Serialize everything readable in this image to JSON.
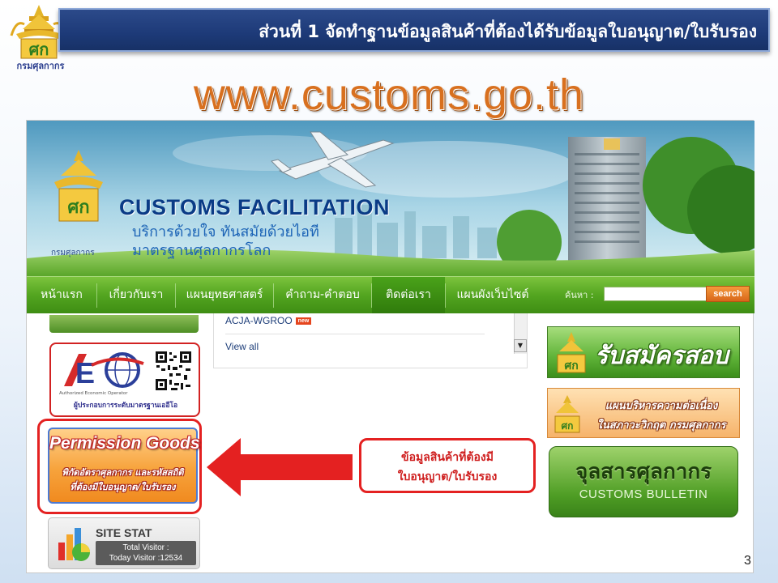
{
  "slide": {
    "logo_text": "กรมศุลกากร",
    "title": "ส่วนที่ 1 จัดทำฐานข้อมูลสินค้าที่ต้องได้รับข้อมูลใบอนุญาต/ใบรับรอง",
    "url": "www.customs.go.th",
    "page_number": "3"
  },
  "site": {
    "banner": {
      "title": "CUSTOMS FACILITATION",
      "subtitle_line1": "บริการด้วยใจ ทันสมัยด้วยไอที",
      "subtitle_line2": "มาตรฐานศุลกากรโลก",
      "logo_caption": "กรมศุลกากร"
    },
    "nav": {
      "items": [
        {
          "label": "หน้าแรก"
        },
        {
          "label": "เกี่ยวกับเรา"
        },
        {
          "label": "แผนยุทธศาสตร์"
        },
        {
          "label": "คำถาม-คำตอบ"
        },
        {
          "label": "ติดต่อเรา"
        },
        {
          "label": "แผนผังเว็บไซต์"
        }
      ],
      "search_label": "ค้นหา :",
      "search_value": "",
      "search_button": "search"
    },
    "news": {
      "item": "ACJA-WGROO",
      "badge": "new",
      "view_all": "View all"
    },
    "aeo": {
      "sub": "Authorized Economic Operator",
      "caption": "ผู้ประกอบการระดับมาตรฐานเออีโอ"
    },
    "permission": {
      "title": "Permission Goods",
      "line1": "พิกัดอัตราศุลกากร และรหัสสถิติ",
      "line2": "ที่ต้องมีใบอนุญาต/ใบรับรอง"
    },
    "stat": {
      "title": "SITE STAT",
      "total": "Total Visitor :",
      "today": "Today Visitor :12534"
    },
    "callout": {
      "line1": "ข้อมูลสินค้าที่ต้องมี",
      "line2": "ใบอนุญาต/ใบรับรอง"
    },
    "right": {
      "apply_exam": "รับสมัครสอบ",
      "bcp_line1": "แผนบริหารความต่อเนื่อง",
      "bcp_line2": "ในสภาวะวิกฤต กรมศุลกากร",
      "bulletin_title": "จุลสารศุลกากร",
      "bulletin_sub": "CUSTOMS BULLETIN"
    }
  },
  "colors": {
    "title_bar": "#1d3a78",
    "url_orange": "#d8701f",
    "nav_green": "#53a520",
    "highlight_red": "#e42121",
    "permission_orange": "#f7a33c"
  }
}
